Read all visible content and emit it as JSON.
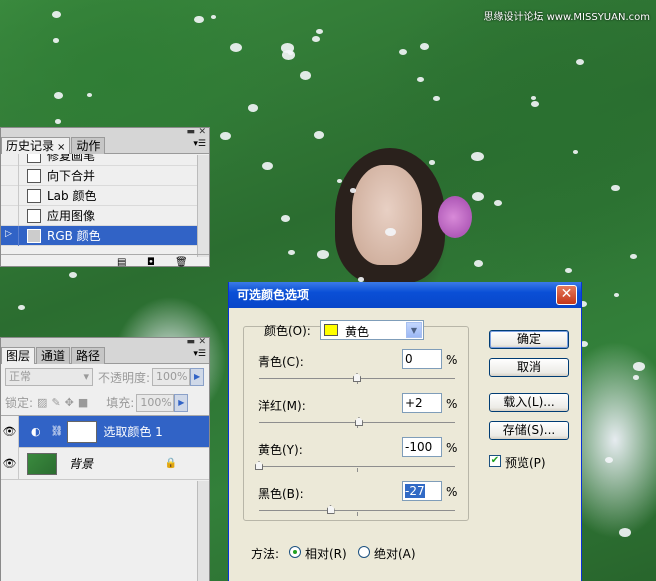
{
  "watermark": "思缘设计论坛 www.MISSYUAN.com",
  "history_panel": {
    "tabs": [
      {
        "label": "历史记录",
        "active": true,
        "close": "×"
      },
      {
        "label": "动作",
        "active": false
      }
    ],
    "items": [
      {
        "label": "修复画笔",
        "selected": false
      },
      {
        "label": "向下合并",
        "selected": false
      },
      {
        "label": "Lab 颜色",
        "selected": false
      },
      {
        "label": "应用图像",
        "selected": false
      },
      {
        "label": "RGB 颜色",
        "selected": true
      }
    ]
  },
  "layers_panel": {
    "tabs": [
      {
        "label": "图层",
        "active": true
      },
      {
        "label": "通道",
        "active": false
      },
      {
        "label": "路径",
        "active": false
      }
    ],
    "blend_mode": "正常",
    "opacity_label": "不透明度:",
    "opacity_value": "100%",
    "lock_label": "锁定:",
    "fill_label": "填充:",
    "fill_value": "100%",
    "layers": [
      {
        "name": "选取颜色 1",
        "selected": true
      },
      {
        "name": "背景",
        "selected": false
      }
    ]
  },
  "dialog": {
    "title": "可选颜色选项",
    "colors_label": "颜色(O):",
    "color_selected": "黄色",
    "swatch_color": "#ffff00",
    "sliders": [
      {
        "label": "青色(C):",
        "value": "0",
        "unit": "%",
        "level": 0
      },
      {
        "label": "洋红(M):",
        "value": "+2",
        "unit": "%",
        "level": 2
      },
      {
        "label": "黄色(Y):",
        "value": "-100",
        "unit": "%",
        "level": -100
      },
      {
        "label": "黑色(B):",
        "value": "-27",
        "unit": "%",
        "level": -27
      }
    ],
    "buttons": {
      "ok": "确定",
      "cancel": "取消",
      "load": "载入(L)...",
      "save": "存储(S)..."
    },
    "preview_label": "预览(P)",
    "preview_checked": true,
    "method_label": "方法:",
    "method_relative": "相对(R)",
    "method_absolute": "绝对(A)",
    "method_selected": "relative"
  }
}
